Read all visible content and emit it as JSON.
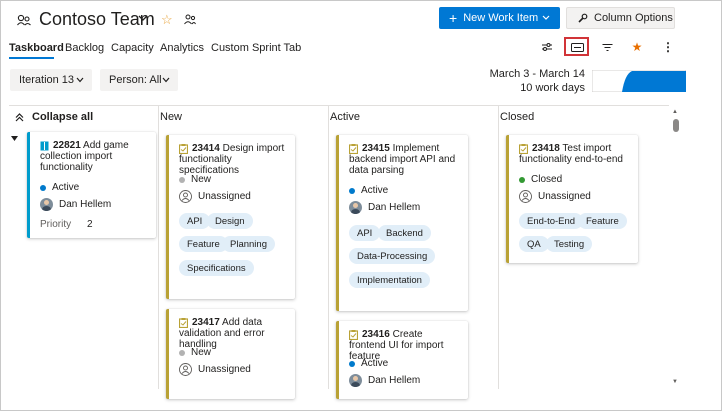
{
  "header": {
    "team_name": "Contoso Team",
    "new_work_item_label": "New Work Item",
    "column_options_label": "Column Options"
  },
  "tabs": [
    {
      "label": "Taskboard",
      "active": true
    },
    {
      "label": "Backlog"
    },
    {
      "label": "Capacity"
    },
    {
      "label": "Analytics"
    },
    {
      "label": "Custom Sprint Tab"
    }
  ],
  "toolbar": {
    "icons": [
      "settings-sliders-icon",
      "card-fields-icon",
      "filter-icon",
      "favorite-star-icon",
      "more-actions-icon"
    ],
    "highlighted": "card-fields-icon",
    "accent_color": "#e86f00",
    "highlight_color": "#d13438"
  },
  "filters": {
    "iteration": "Iteration 13",
    "person": "Person: All"
  },
  "sprint": {
    "dates": "March 3 - March 14",
    "work_days": "10 work days"
  },
  "board": {
    "collapse_label": "Collapse all",
    "columns": [
      "New",
      "Active",
      "Closed"
    ],
    "story": {
      "id": "22821",
      "title": "Add game collection import functionality",
      "state": "Active",
      "assignee": "Dan Hellem",
      "priority_label": "Priority",
      "priority_value": "2"
    },
    "tasks": [
      {
        "id": "23414",
        "title": "Design import functionality specifications",
        "state": "New",
        "assignee": "Unassigned",
        "tags": [
          "API",
          "Design",
          "Feature",
          "Planning",
          "Specifications"
        ]
      },
      {
        "id": "23417",
        "title": "Add data validation and error handling",
        "state": "New",
        "assignee": "Unassigned",
        "tags": []
      },
      {
        "id": "23415",
        "title": "Implement backend import API and data parsing",
        "state": "Active",
        "assignee": "Dan Hellem",
        "tags": [
          "API",
          "Backend",
          "Data-Processing",
          "Implementation"
        ]
      },
      {
        "id": "23416",
        "title": "Create frontend UI for import feature",
        "state": "Active",
        "assignee": "Dan Hellem",
        "tags": []
      },
      {
        "id": "23418",
        "title": "Test import functionality end-to-end",
        "state": "Closed",
        "assignee": "Unassigned",
        "tags": [
          "End-to-End",
          "Feature",
          "QA",
          "Testing"
        ]
      }
    ]
  },
  "colors": {
    "primary": "#0078d4",
    "task_bar": "#b9a236",
    "story_bar": "#009ccc",
    "state_new": "#b2b2b2",
    "state_active": "#007acc",
    "state_closed": "#339933",
    "tag_bg": "#e1eef8"
  }
}
